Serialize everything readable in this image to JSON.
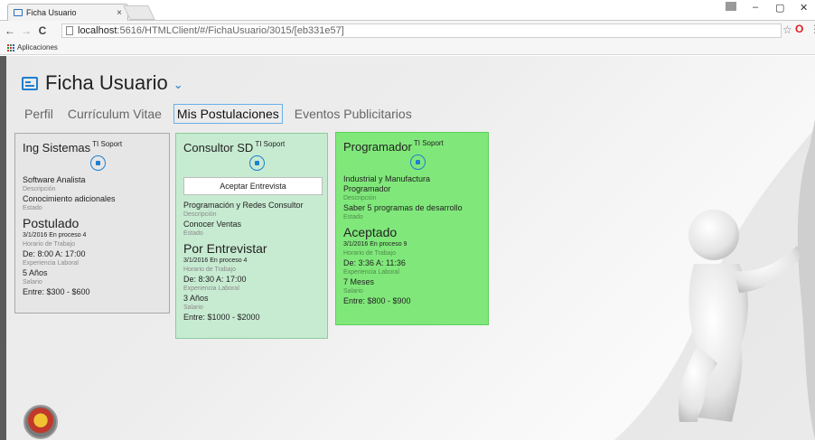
{
  "browser": {
    "tab_title": "Ficha Usuario",
    "tab_close": "×",
    "win_min": "–",
    "win_restore": "▢",
    "win_close": "✕",
    "nav_back": "←",
    "nav_forward": "→",
    "nav_reload": "C",
    "url_host": "localhost",
    "url_rest": ":5616/HTMLClient/#/FichaUsuario/3015/[eb331e57]",
    "star": "☆",
    "opera": "O",
    "menu": "⋮",
    "bookmark_apps": "Aplicaciones"
  },
  "header": {
    "title": "Ficha Usuario",
    "chevron": "⌄"
  },
  "tabs": [
    {
      "label": "Perfil",
      "active": false
    },
    {
      "label": "Currículum Vitae",
      "active": false
    },
    {
      "label": "Mis Postulaciones",
      "active": true
    },
    {
      "label": "Eventos Publicitarios",
      "active": false
    }
  ],
  "cards": [
    {
      "title": "Ing Sistemas",
      "company": "TI Soport",
      "l1": "Software Analista",
      "c1": "Descripción",
      "l2": "Conocimiento adicionales",
      "c2": "Estado",
      "status": "Postulado",
      "date": "3/1/2016 En proceso 4",
      "c3": "Horario de Trabajo",
      "schedule": "De: 8:00 A: 17:00",
      "c4": "Experiencia Laboral",
      "experience": "5 Años",
      "c5": "Salario",
      "salary": "Entre: $300 - $600"
    },
    {
      "title": "Consultor SD",
      "company": "TI Soport",
      "button": "Aceptar Entrevista",
      "l1": "Programación y Redes Consultor",
      "c1": "Descripción",
      "l2": "Conocer Ventas",
      "c2": "Estado",
      "status": "Por Entrevistar",
      "date": "3/1/2016 En proceso 4",
      "c3": "Horario de Trabajo",
      "schedule": "De: 8:30 A: 17:00",
      "c4": "Experiencia Laboral",
      "experience": "3 Años",
      "c5": "Salario",
      "salary": "Entre: $1000 - $2000"
    },
    {
      "title": "Programador",
      "company": "TI Soport",
      "l0": "Industrial y Manufactura",
      "l1": "Programador",
      "c1": "Descripción",
      "l2": "Saber 5 programas de desarrollo",
      "c2": "Estado",
      "status": "Aceptado",
      "date": "3/1/2016 En proceso 9",
      "c3": "Horario de Trabajo",
      "schedule": "De: 3:36 A: 11:36",
      "c4": "Experiencia Laboral",
      "experience": "7 Meses",
      "c5": "Salario",
      "salary": "Entre: $800 - $900"
    }
  ],
  "colors": {
    "accent": "#1e7fd0",
    "card_gray": "#e6e6e6",
    "card_light_green": "#c7ebd1",
    "card_green": "#80e87a"
  }
}
